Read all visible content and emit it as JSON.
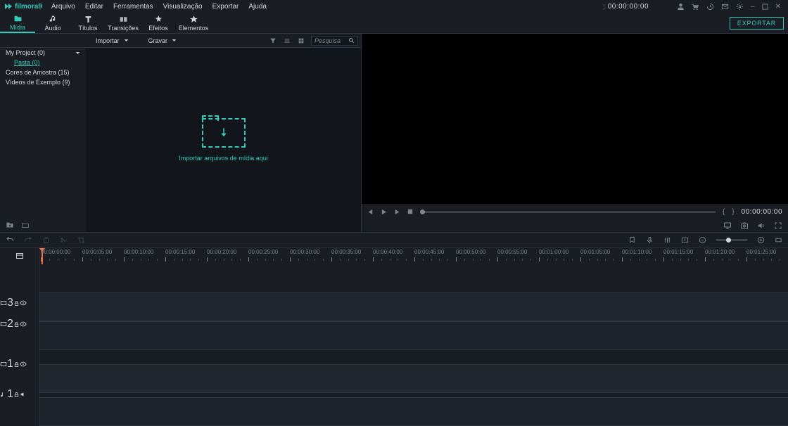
{
  "app_name": "filmora9",
  "menu": [
    "Arquivo",
    "Editar",
    "Ferramentas",
    "Visualização",
    "Exportar",
    "Ajuda"
  ],
  "player_timecode": ": 00:00:00:00",
  "tool_tabs": [
    {
      "label": "Mídia",
      "icon": "folder"
    },
    {
      "label": "Áudio",
      "icon": "music"
    },
    {
      "label": "Títulos",
      "icon": "text"
    },
    {
      "label": "Transições",
      "icon": "transition"
    },
    {
      "label": "Efeitos",
      "icon": "sparkle"
    },
    {
      "label": "Elementos",
      "icon": "star"
    }
  ],
  "export_label": "EXPORTAR",
  "browser_bar": {
    "import_label": "Importar",
    "record_label": "Gravar",
    "search_placeholder": "Pesquisa"
  },
  "folder_tree": [
    {
      "label": "My Project (0)",
      "sub": false,
      "sel": false,
      "expand": true
    },
    {
      "label": "Pasta (0)",
      "sub": true,
      "sel": true
    },
    {
      "label": "Cores de Amostra (15)",
      "sub": false,
      "sel": false
    },
    {
      "label": "Vídeos de Exemplo (9)",
      "sub": false,
      "sel": false
    }
  ],
  "drop_label": "Importar arquivos de mídia aqui",
  "preview": {
    "right_timecode": "00:00:00:00",
    "braces_l": "{",
    "braces_r": "}"
  },
  "ruler_ticks": [
    "00:00:00:00",
    "00:00:05:00",
    "00:00:10:00",
    "00:00:15:00",
    "00:00:20:00",
    "00:00:25:00",
    "00:00:30:00",
    "00:00:35:00",
    "00:00:40:00",
    "00:00:45:00",
    "00:00:50:00",
    "00:00:55:00",
    "00:01:00:00",
    "00:01:05:00",
    "00:01:10:00",
    "00:01:15:00",
    "00:01:20:00",
    "00:01:25:00"
  ],
  "tracks": {
    "v3": "3",
    "v2": "2",
    "v1": "1",
    "a1": "1"
  }
}
